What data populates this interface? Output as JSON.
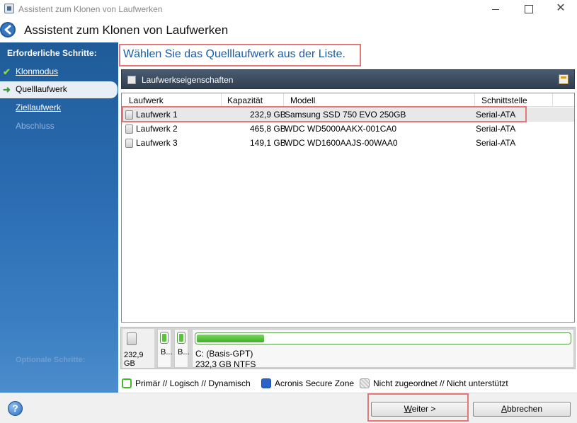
{
  "window": {
    "title": "Assistent zum Klonen von Laufwerken"
  },
  "header": {
    "title": "Assistent zum Klonen von Laufwerken"
  },
  "sidebar": {
    "heading": "Erforderliche Schritte:",
    "items": [
      {
        "label": "Klonmodus",
        "state": "done"
      },
      {
        "label": "Quelllaufwerk",
        "state": "active"
      },
      {
        "label": "Ziellaufwerk",
        "state": "link"
      },
      {
        "label": "Abschluss",
        "state": "disabled"
      }
    ],
    "footer": "Optionale Schritte:"
  },
  "main": {
    "title": "Wählen Sie das Quelllaufwerk aus der Liste.",
    "properties_label": "Laufwerkseigenschaften"
  },
  "table": {
    "columns": [
      "Laufwerk",
      "Kapazität",
      "Modell",
      "Schnittstelle"
    ],
    "rows": [
      {
        "drive": "Laufwerk 1",
        "capacity": "232,9 GB",
        "model": "Samsung SSD 750 EVO 250GB",
        "interface": "Serial-ATA",
        "selected": true
      },
      {
        "drive": "Laufwerk 2",
        "capacity": "465,8 GB",
        "model": "WDC WD5000AAKX-001CA0",
        "interface": "Serial-ATA",
        "selected": false
      },
      {
        "drive": "Laufwerk 3",
        "capacity": "149,1 GB",
        "model": "WDC WD1600AAJS-00WAA0",
        "interface": "Serial-ATA",
        "selected": false
      }
    ]
  },
  "diskmap": {
    "disk_size": "232,9 GB",
    "small_parts": [
      "B...",
      "B..."
    ],
    "main_part_label": "C: (Basis-GPT)",
    "main_part_size": "232,3 GB  NTFS",
    "used_fraction": 0.18
  },
  "legend": {
    "primary": "Primär // Logisch // Dynamisch",
    "secure": "Acronis Secure Zone",
    "unallocated": "Nicht zugeordnet // Nicht unterstützt"
  },
  "footer": {
    "next_label": "Weiter >",
    "cancel_label": "Abbrechen"
  }
}
